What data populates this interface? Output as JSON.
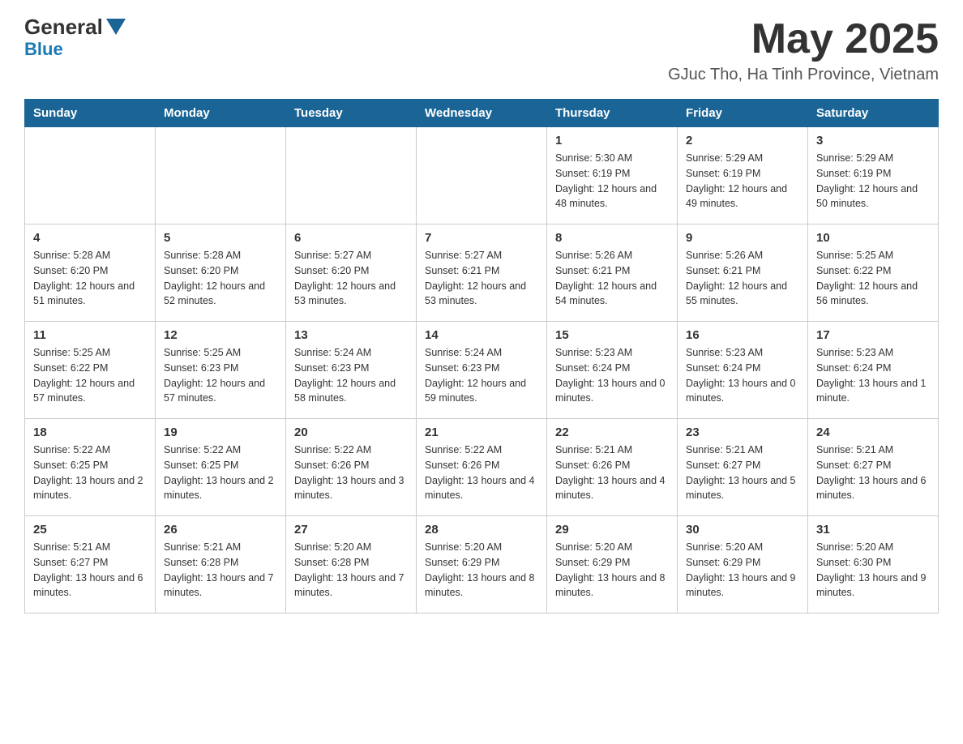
{
  "header": {
    "logo_general": "General",
    "logo_blue": "Blue",
    "month_year": "May 2025",
    "location": "GJuc Tho, Ha Tinh Province, Vietnam"
  },
  "days_of_week": [
    "Sunday",
    "Monday",
    "Tuesday",
    "Wednesday",
    "Thursday",
    "Friday",
    "Saturday"
  ],
  "weeks": [
    [
      {
        "day": "",
        "info": ""
      },
      {
        "day": "",
        "info": ""
      },
      {
        "day": "",
        "info": ""
      },
      {
        "day": "",
        "info": ""
      },
      {
        "day": "1",
        "info": "Sunrise: 5:30 AM\nSunset: 6:19 PM\nDaylight: 12 hours and 48 minutes."
      },
      {
        "day": "2",
        "info": "Sunrise: 5:29 AM\nSunset: 6:19 PM\nDaylight: 12 hours and 49 minutes."
      },
      {
        "day": "3",
        "info": "Sunrise: 5:29 AM\nSunset: 6:19 PM\nDaylight: 12 hours and 50 minutes."
      }
    ],
    [
      {
        "day": "4",
        "info": "Sunrise: 5:28 AM\nSunset: 6:20 PM\nDaylight: 12 hours and 51 minutes."
      },
      {
        "day": "5",
        "info": "Sunrise: 5:28 AM\nSunset: 6:20 PM\nDaylight: 12 hours and 52 minutes."
      },
      {
        "day": "6",
        "info": "Sunrise: 5:27 AM\nSunset: 6:20 PM\nDaylight: 12 hours and 53 minutes."
      },
      {
        "day": "7",
        "info": "Sunrise: 5:27 AM\nSunset: 6:21 PM\nDaylight: 12 hours and 53 minutes."
      },
      {
        "day": "8",
        "info": "Sunrise: 5:26 AM\nSunset: 6:21 PM\nDaylight: 12 hours and 54 minutes."
      },
      {
        "day": "9",
        "info": "Sunrise: 5:26 AM\nSunset: 6:21 PM\nDaylight: 12 hours and 55 minutes."
      },
      {
        "day": "10",
        "info": "Sunrise: 5:25 AM\nSunset: 6:22 PM\nDaylight: 12 hours and 56 minutes."
      }
    ],
    [
      {
        "day": "11",
        "info": "Sunrise: 5:25 AM\nSunset: 6:22 PM\nDaylight: 12 hours and 57 minutes."
      },
      {
        "day": "12",
        "info": "Sunrise: 5:25 AM\nSunset: 6:23 PM\nDaylight: 12 hours and 57 minutes."
      },
      {
        "day": "13",
        "info": "Sunrise: 5:24 AM\nSunset: 6:23 PM\nDaylight: 12 hours and 58 minutes."
      },
      {
        "day": "14",
        "info": "Sunrise: 5:24 AM\nSunset: 6:23 PM\nDaylight: 12 hours and 59 minutes."
      },
      {
        "day": "15",
        "info": "Sunrise: 5:23 AM\nSunset: 6:24 PM\nDaylight: 13 hours and 0 minutes."
      },
      {
        "day": "16",
        "info": "Sunrise: 5:23 AM\nSunset: 6:24 PM\nDaylight: 13 hours and 0 minutes."
      },
      {
        "day": "17",
        "info": "Sunrise: 5:23 AM\nSunset: 6:24 PM\nDaylight: 13 hours and 1 minute."
      }
    ],
    [
      {
        "day": "18",
        "info": "Sunrise: 5:22 AM\nSunset: 6:25 PM\nDaylight: 13 hours and 2 minutes."
      },
      {
        "day": "19",
        "info": "Sunrise: 5:22 AM\nSunset: 6:25 PM\nDaylight: 13 hours and 2 minutes."
      },
      {
        "day": "20",
        "info": "Sunrise: 5:22 AM\nSunset: 6:26 PM\nDaylight: 13 hours and 3 minutes."
      },
      {
        "day": "21",
        "info": "Sunrise: 5:22 AM\nSunset: 6:26 PM\nDaylight: 13 hours and 4 minutes."
      },
      {
        "day": "22",
        "info": "Sunrise: 5:21 AM\nSunset: 6:26 PM\nDaylight: 13 hours and 4 minutes."
      },
      {
        "day": "23",
        "info": "Sunrise: 5:21 AM\nSunset: 6:27 PM\nDaylight: 13 hours and 5 minutes."
      },
      {
        "day": "24",
        "info": "Sunrise: 5:21 AM\nSunset: 6:27 PM\nDaylight: 13 hours and 6 minutes."
      }
    ],
    [
      {
        "day": "25",
        "info": "Sunrise: 5:21 AM\nSunset: 6:27 PM\nDaylight: 13 hours and 6 minutes."
      },
      {
        "day": "26",
        "info": "Sunrise: 5:21 AM\nSunset: 6:28 PM\nDaylight: 13 hours and 7 minutes."
      },
      {
        "day": "27",
        "info": "Sunrise: 5:20 AM\nSunset: 6:28 PM\nDaylight: 13 hours and 7 minutes."
      },
      {
        "day": "28",
        "info": "Sunrise: 5:20 AM\nSunset: 6:29 PM\nDaylight: 13 hours and 8 minutes."
      },
      {
        "day": "29",
        "info": "Sunrise: 5:20 AM\nSunset: 6:29 PM\nDaylight: 13 hours and 8 minutes."
      },
      {
        "day": "30",
        "info": "Sunrise: 5:20 AM\nSunset: 6:29 PM\nDaylight: 13 hours and 9 minutes."
      },
      {
        "day": "31",
        "info": "Sunrise: 5:20 AM\nSunset: 6:30 PM\nDaylight: 13 hours and 9 minutes."
      }
    ]
  ]
}
